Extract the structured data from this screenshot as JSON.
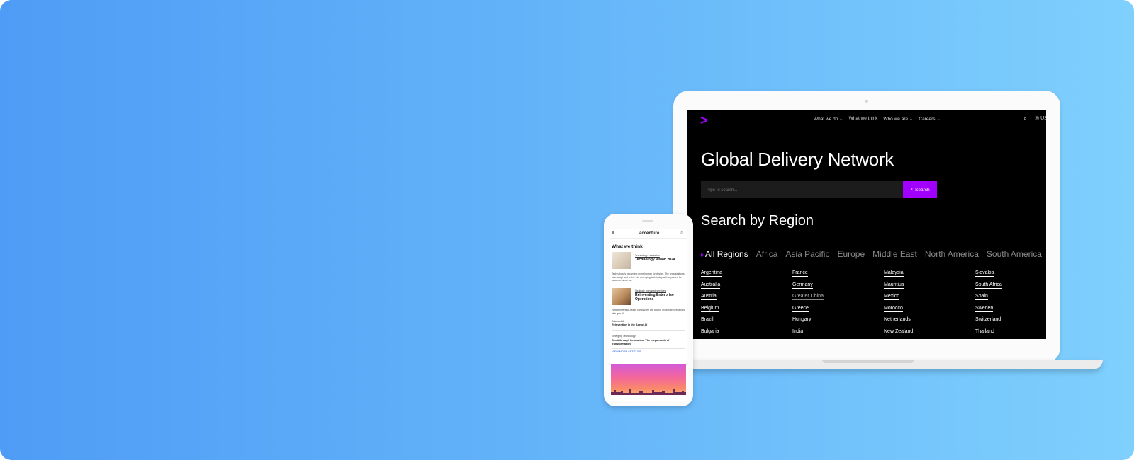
{
  "laptop": {
    "nav": {
      "logo_glyph": ">",
      "links": [
        "What we do",
        "What we think",
        "Who we are",
        "Careers"
      ],
      "dropdown_flags": [
        true,
        false,
        true,
        true
      ],
      "chevron_glyph": "⌄",
      "search_icon": "search-icon",
      "search_glyph": "⌕",
      "globe_glyph": "◎",
      "locale": "US"
    },
    "title": "Global Delivery Network",
    "search": {
      "placeholder": "Type to search...",
      "button_glyph": "⌕",
      "button_label": "Search"
    },
    "region_heading": "Search by Region",
    "tabs": [
      "All Regions",
      "Africa",
      "Asia Pacific",
      "Europe",
      "Middle East",
      "North America",
      "South America"
    ],
    "active_tab": "All Regions",
    "tab_marker": "▸",
    "countries": [
      [
        "Argentina",
        "France",
        "Malaysia",
        "Slovakia"
      ],
      [
        "Australia",
        "Germany",
        "Mauritius",
        "South Africa"
      ],
      [
        "Austria",
        "Greater China",
        "Mexico",
        "Spain"
      ],
      [
        "Belgium",
        "Greece",
        "Morocco",
        "Sweden"
      ],
      [
        "Brazil",
        "Hungary",
        "Netherlands",
        "Switzerland"
      ],
      [
        "Bulgaria",
        "India",
        "New Zealand",
        "Thailand"
      ]
    ],
    "muted_country": "Greater China",
    "accent_color": "#a100ff"
  },
  "phone": {
    "menu_glyph": "≡",
    "logo": "accenture",
    "search_glyph": "⌕",
    "heading": "What we think",
    "articles": [
      {
        "tag": "Technology Innovation",
        "title": "Technology Vision 2024",
        "description": "Technology's becoming more human by design. The organizations who adopt and refine this emerging tech today will be poised for success tomorrow."
      },
      {
        "tag": "Strategic managed services",
        "title": "Reinventing Enterprise Operations",
        "description": "How reinvention-ready companies are driving growth and reliability with gen AI"
      }
    ],
    "list_items": [
      {
        "tag": "Data and AI",
        "title": "Reinvention in the Age of AI"
      },
      {
        "tag": "Emerging Technology",
        "title": "Breakthrough Innovation: The megatrends of transformation"
      }
    ],
    "view_more": "VIEW MORE ARTICLES  →"
  }
}
